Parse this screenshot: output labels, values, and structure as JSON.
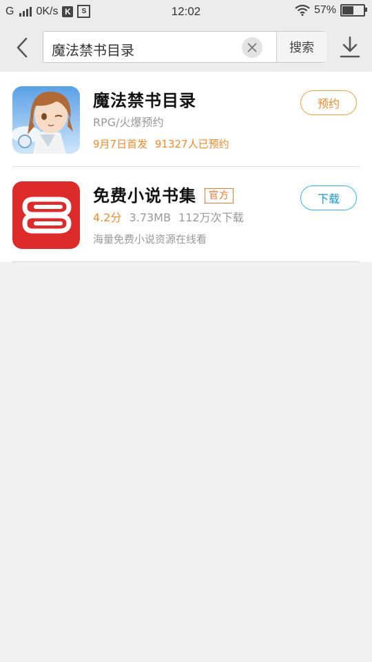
{
  "status_bar": {
    "network": "G",
    "speed": "0K/s",
    "time": "12:02",
    "battery": "57%",
    "battery_level": 0.57
  },
  "search": {
    "query": "魔法禁书目录",
    "button_label": "搜索"
  },
  "results": [
    {
      "name": "魔法禁书目录",
      "subtitle": "RPG/火爆预约",
      "release": "9月7日首发",
      "count": "91327人已预约",
      "action": "预约"
    },
    {
      "name": "免费小说书集",
      "badge": "官方",
      "rating": "4.2分",
      "size": "3.73MB",
      "downloads": "112万次下载",
      "description": "海量免费小说资源在线看",
      "action": "下载"
    }
  ],
  "colors": {
    "accent_orange": "#f08a2c",
    "accent_blue": "#1a9ad8",
    "app2_icon_red": "#dd2a2a"
  }
}
